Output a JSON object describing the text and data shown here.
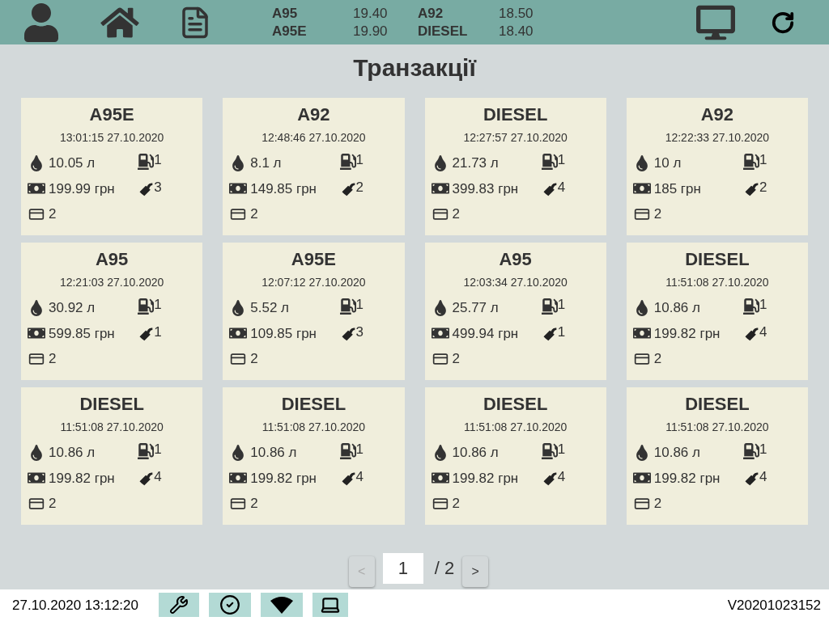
{
  "prices": [
    {
      "fuel": "A95",
      "price": "19.40"
    },
    {
      "fuel": "A95E",
      "price": "19.90"
    },
    {
      "fuel": "A92",
      "price": "18.50"
    },
    {
      "fuel": "DIESEL",
      "price": "18.40"
    }
  ],
  "title": "Транзакції",
  "transactions": [
    {
      "fuel": "A95E",
      "time": "13:01:15 27.10.2020",
      "volume": "10.05 л",
      "amount": "199.99 грн",
      "pump": "1",
      "nozzle": "3",
      "payment": "2"
    },
    {
      "fuel": "A92",
      "time": "12:48:46 27.10.2020",
      "volume": "8.1 л",
      "amount": "149.85 грн",
      "pump": "1",
      "nozzle": "2",
      "payment": "2"
    },
    {
      "fuel": "DIESEL",
      "time": "12:27:57 27.10.2020",
      "volume": "21.73 л",
      "amount": "399.83 грн",
      "pump": "1",
      "nozzle": "4",
      "payment": "2"
    },
    {
      "fuel": "A92",
      "time": "12:22:33 27.10.2020",
      "volume": "10 л",
      "amount": "185 грн",
      "pump": "1",
      "nozzle": "2",
      "payment": "2"
    },
    {
      "fuel": "A95",
      "time": "12:21:03 27.10.2020",
      "volume": "30.92 л",
      "amount": "599.85 грн",
      "pump": "1",
      "nozzle": "1",
      "payment": "2"
    },
    {
      "fuel": "A95E",
      "time": "12:07:12 27.10.2020",
      "volume": "5.52 л",
      "amount": "109.85 грн",
      "pump": "1",
      "nozzle": "3",
      "payment": "2"
    },
    {
      "fuel": "A95",
      "time": "12:03:34 27.10.2020",
      "volume": "25.77 л",
      "amount": "499.94 грн",
      "pump": "1",
      "nozzle": "1",
      "payment": "2"
    },
    {
      "fuel": "DIESEL",
      "time": "11:51:08 27.10.2020",
      "volume": "10.86 л",
      "amount": "199.82 грн",
      "pump": "1",
      "nozzle": "4",
      "payment": "2"
    },
    {
      "fuel": "DIESEL",
      "time": "11:51:08 27.10.2020",
      "volume": "10.86 л",
      "amount": "199.82 грн",
      "pump": "1",
      "nozzle": "4",
      "payment": "2"
    },
    {
      "fuel": "DIESEL",
      "time": "11:51:08 27.10.2020",
      "volume": "10.86 л",
      "amount": "199.82 грн",
      "pump": "1",
      "nozzle": "4",
      "payment": "2"
    },
    {
      "fuel": "DIESEL",
      "time": "11:51:08 27.10.2020",
      "volume": "10.86 л",
      "amount": "199.82 грн",
      "pump": "1",
      "nozzle": "4",
      "payment": "2"
    },
    {
      "fuel": "DIESEL",
      "time": "11:51:08 27.10.2020",
      "volume": "10.86 л",
      "amount": "199.82 грн",
      "pump": "1",
      "nozzle": "4",
      "payment": "2"
    }
  ],
  "pagination": {
    "prev": {
      "label": "<",
      "disabled": true
    },
    "page": "1",
    "total": "/ 2",
    "next": {
      "label": ">",
      "disabled": false
    }
  },
  "status_bar": {
    "datetime": "27.10.2020 13:12:20",
    "version": "V20201023152"
  }
}
